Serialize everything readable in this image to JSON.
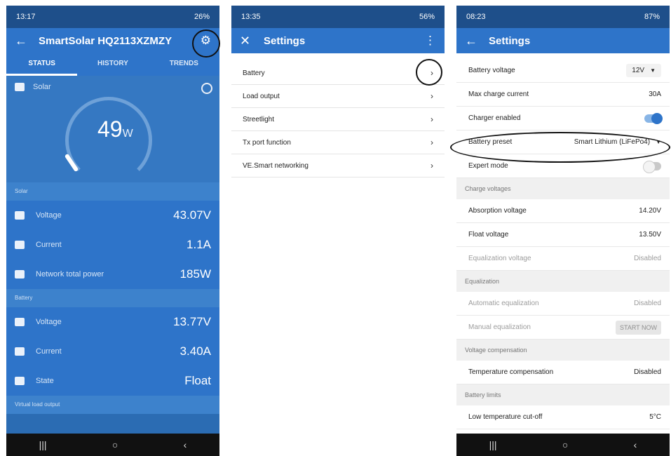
{
  "panel1": {
    "status": {
      "time": "13:17",
      "battery": "26%"
    },
    "title": "SmartSolar HQ2113XZMZY",
    "tabs": [
      "STATUS",
      "HISTORY",
      "TRENDS"
    ],
    "solar_card": {
      "label": "Solar",
      "power": "49",
      "unit": "W"
    },
    "sections": [
      {
        "title": "Solar",
        "rows": [
          {
            "label": "Voltage",
            "value": "43.07V"
          },
          {
            "label": "Current",
            "value": "1.1A"
          },
          {
            "label": "Network total power",
            "value": "185W"
          }
        ]
      },
      {
        "title": "Battery",
        "rows": [
          {
            "label": "Voltage",
            "value": "13.77V"
          },
          {
            "label": "Current",
            "value": "3.40A"
          },
          {
            "label": "State",
            "value": "Float"
          }
        ]
      }
    ],
    "section_last": "Virtual load output"
  },
  "panel2": {
    "status": {
      "time": "13:35",
      "battery": "56%"
    },
    "title": "Settings",
    "items": [
      "Battery",
      "Load output",
      "Streetlight",
      "Tx port function",
      "VE.Smart networking"
    ]
  },
  "panel3": {
    "status": {
      "time": "08:23",
      "battery": "87%"
    },
    "title": "Settings",
    "rows_top": [
      {
        "label": "Battery voltage",
        "value": "12V"
      },
      {
        "label": "Max charge current",
        "value": "30A"
      },
      {
        "label": "Charger enabled"
      },
      {
        "label": "Battery preset",
        "value": "Smart Lithium (LiFePo4)"
      },
      {
        "label": "Expert mode"
      }
    ],
    "charge_voltages": {
      "title": "Charge voltages",
      "rows": [
        {
          "label": "Absorption voltage",
          "value": "14.20V"
        },
        {
          "label": "Float voltage",
          "value": "13.50V"
        },
        {
          "label": "Equalization voltage",
          "value": "Disabled"
        }
      ]
    },
    "equalization": {
      "title": "Equalization",
      "rows": [
        {
          "label": "Automatic equalization",
          "value": "Disabled"
        },
        {
          "label": "Manual equalization",
          "button": "START NOW"
        }
      ]
    },
    "voltage_compensation": {
      "title": "Voltage compensation",
      "rows": [
        {
          "label": "Temperature compensation",
          "value": "Disabled"
        }
      ]
    },
    "battery_limits": {
      "title": "Battery limits",
      "rows": [
        {
          "label": "Low temperature cut-off",
          "value": "5°C"
        }
      ]
    }
  }
}
